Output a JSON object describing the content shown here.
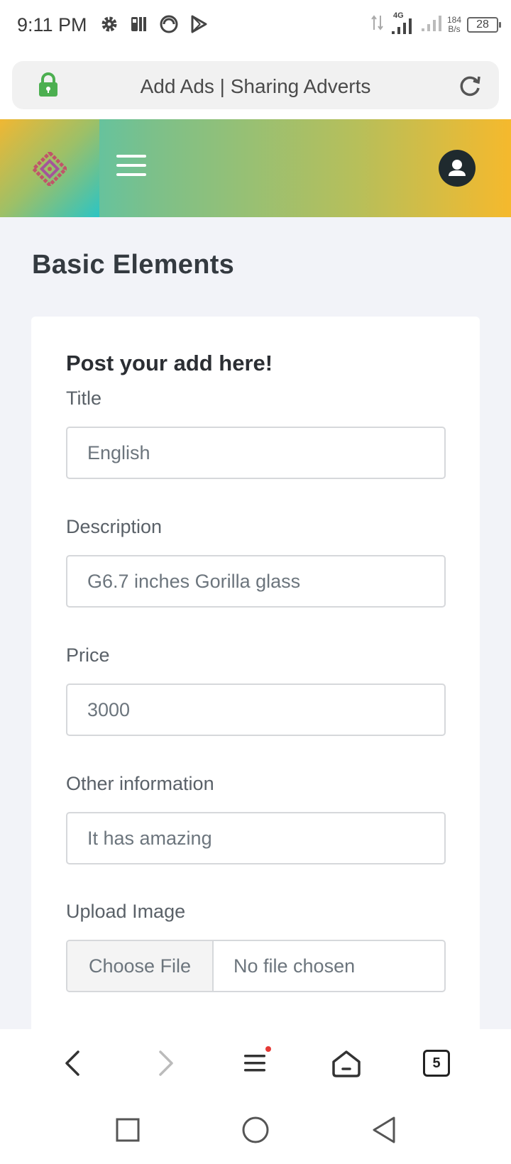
{
  "status_bar": {
    "time": "9:11 PM",
    "network_type": "4G",
    "speed_value": "184",
    "speed_unit": "B/s",
    "battery": "28"
  },
  "address_bar": {
    "title": "Add Ads | Sharing Adverts"
  },
  "header": {
    "brand_icon": "diamond-logo",
    "menu_icon": "hamburger-icon",
    "profile_icon": "user-avatar-icon"
  },
  "page": {
    "title": "Basic Elements"
  },
  "form": {
    "heading": "Post your add here!",
    "fields": [
      {
        "label": "Title",
        "value": "English"
      },
      {
        "label": "Description",
        "value": "G6.7 inches Gorilla glass"
      },
      {
        "label": "Price",
        "value": "3000"
      },
      {
        "label": "Other information",
        "value": "It has amazing"
      }
    ],
    "upload": {
      "label": "Upload Image",
      "button": "Choose File",
      "status": "No file chosen"
    }
  },
  "browser_nav": {
    "tabs_count": "5"
  },
  "colors": {
    "header_gradient_start": "#3fc6bf",
    "header_gradient_end": "#f5b92d",
    "lock_green": "#4caf50",
    "content_bg": "#f2f3f8"
  }
}
